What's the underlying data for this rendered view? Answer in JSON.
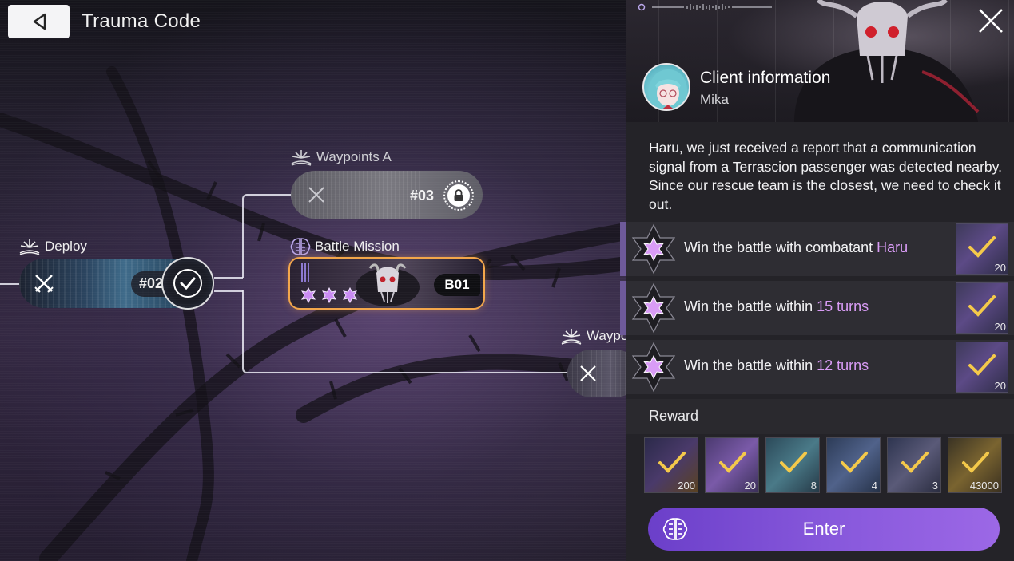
{
  "header": {
    "title": "Trauma Code",
    "back_icon": "back-arrow-icon"
  },
  "map": {
    "nodes": {
      "deploy": {
        "label": "Deploy",
        "number": "#02",
        "status": "completed"
      },
      "waypoints_a": {
        "label": "Waypoints A",
        "number": "#03",
        "status": "locked"
      },
      "battle_mission": {
        "label": "Battle Mission",
        "code": "B01",
        "stars": 3
      },
      "waypoints_b": {
        "label": "Waypo"
      }
    }
  },
  "panel": {
    "client_title": "Client information",
    "client_name": "Mika",
    "message": "Haru, we just received a report that a communication signal from a Terrascion passenger was detected nearby. Since our rescue team is the closest, we need to check it out.",
    "objectives": [
      {
        "prefix": "Win the battle with combatant ",
        "highlight": "Haru",
        "reward_count": "20",
        "completed": true
      },
      {
        "prefix": "Win the battle within ",
        "highlight": "15 turns",
        "reward_count": "20",
        "completed": true
      },
      {
        "prefix": "Win the battle within ",
        "highlight": "12 turns",
        "reward_count": "20",
        "completed": true
      }
    ],
    "reward_title": "Reward",
    "rewards": [
      {
        "count": "200",
        "color": "#2b2a4a"
      },
      {
        "count": "20",
        "color": "#4b3a70"
      },
      {
        "count": "8",
        "color": "#2c4a5a"
      },
      {
        "count": "4",
        "color": "#2d3c58"
      },
      {
        "count": "3",
        "color": "#2e3550"
      },
      {
        "count": "43000",
        "color": "#3a3324"
      }
    ],
    "enter_label": "Enter"
  },
  "colors": {
    "accent": "#8657db",
    "highlight": "#d99cf6",
    "battle_border": "#f3a64a",
    "check": "#f4c94a"
  }
}
